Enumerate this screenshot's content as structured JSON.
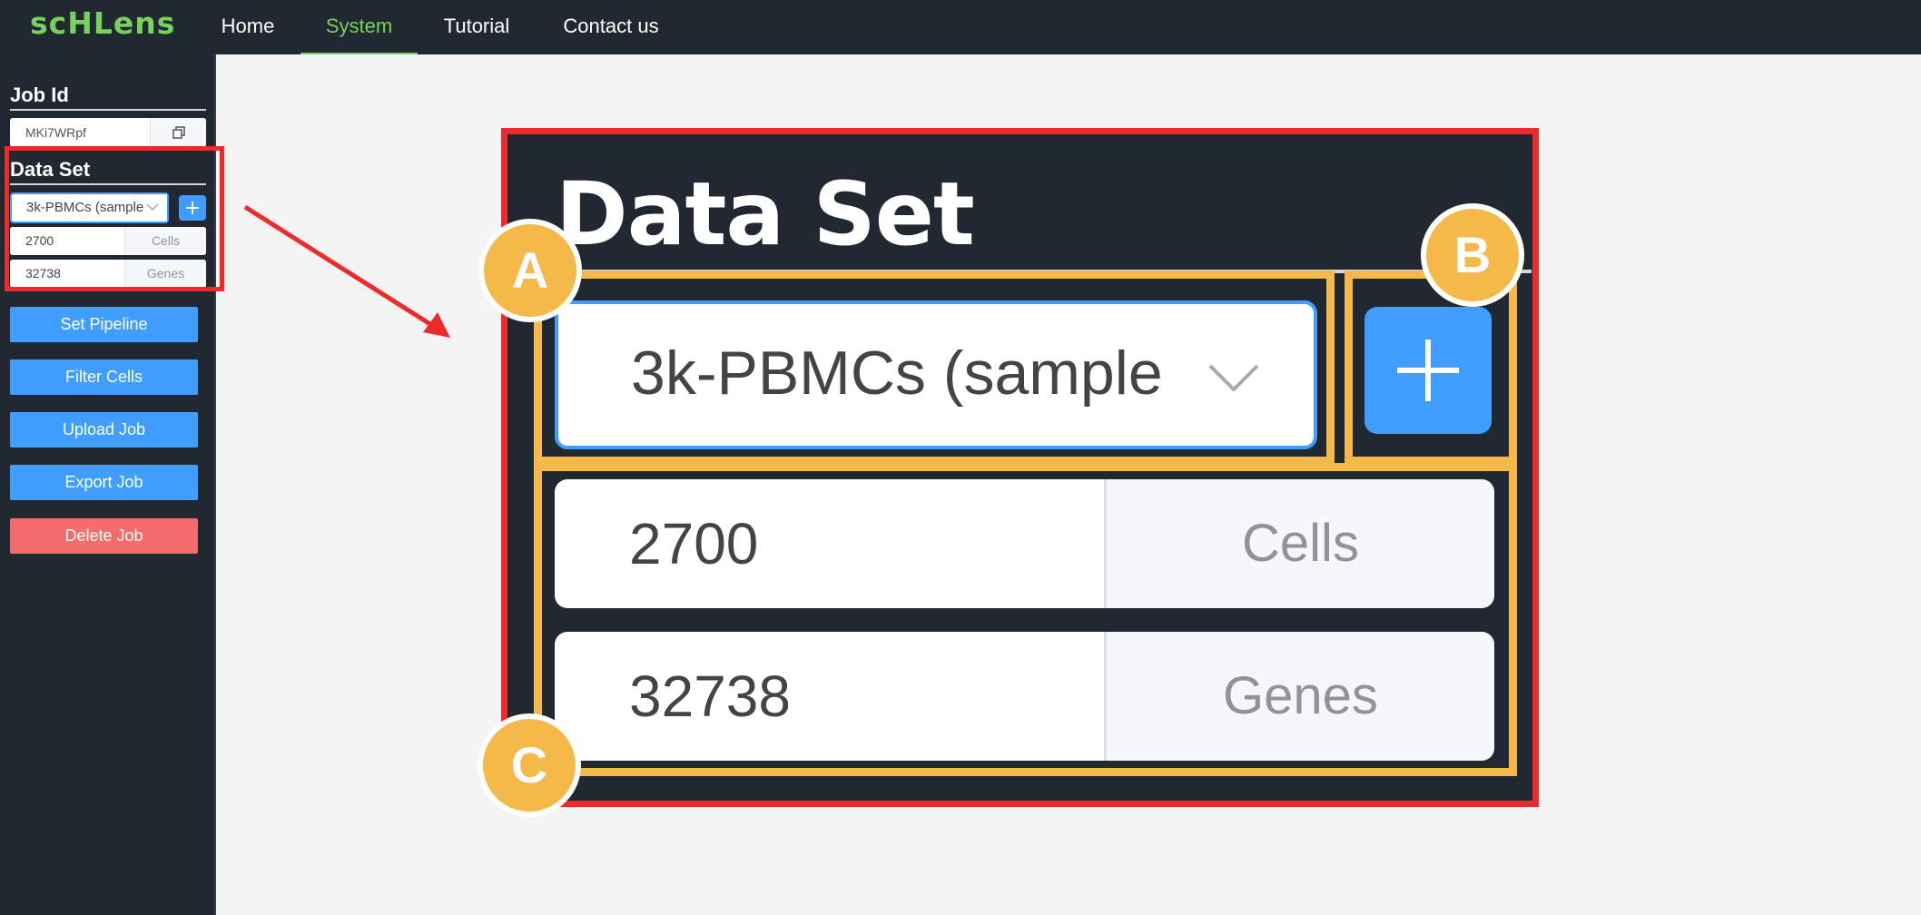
{
  "app": {
    "logo": "scHLens"
  },
  "nav": {
    "home": "Home",
    "system": "System",
    "tutorial": "Tutorial",
    "contact": "Contact us"
  },
  "sidebar": {
    "job_id_heading": "Job Id",
    "job_id_value": "MKi7WRpf",
    "dataset_heading": "Data Set",
    "dataset_selected": "3k-PBMCs (sample",
    "cells_value": "2700",
    "cells_unit": "Cells",
    "genes_value": "32738",
    "genes_unit": "Genes",
    "buttons": {
      "set_pipeline": "Set Pipeline",
      "filter_cells": "Filter Cells",
      "upload_job": "Upload Job",
      "export_job": "Export Job",
      "delete_job": "Delete Job"
    }
  },
  "zoom": {
    "title": "Data Set",
    "selected": "3k-PBMCs (sample",
    "cells_value": "2700",
    "cells_unit": "Cells",
    "genes_value": "32738",
    "genes_unit": "Genes"
  },
  "callouts": {
    "a": "A",
    "b": "B",
    "c": "C"
  },
  "colors": {
    "nav_bg": "#222831",
    "accent_green": "#76d25a",
    "primary_blue": "#409eff",
    "danger": "#f56c6c",
    "highlight_red": "#ee2b2b",
    "callout_yellow": "#f4b949"
  }
}
